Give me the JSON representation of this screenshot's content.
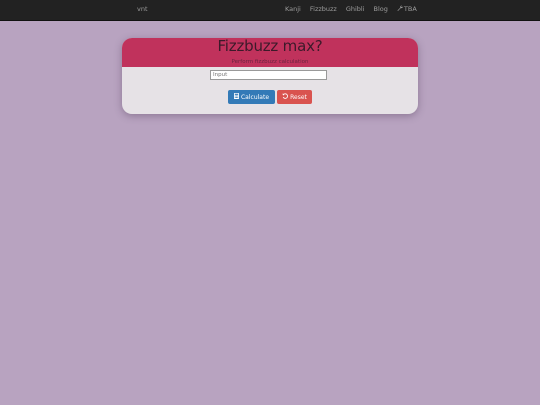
{
  "navbar": {
    "brand": "vnt",
    "links": [
      {
        "label": "Kanji"
      },
      {
        "label": "Fizzbuzz"
      },
      {
        "label": "Ghibli"
      },
      {
        "label": "Blog"
      },
      {
        "label": "TBA",
        "icon": "wrench-icon"
      }
    ]
  },
  "card": {
    "title": "Fizzbuzz max?",
    "subtitle": "Perform fizzbuzz calculation",
    "input": {
      "placeholder": "Input",
      "value": ""
    },
    "buttons": {
      "calculate": {
        "label": "Calculate",
        "icon": "calculator-icon"
      },
      "reset": {
        "label": "Reset",
        "icon": "undo-icon"
      }
    }
  },
  "colors": {
    "page_background": "#b8a3c0",
    "navbar": "#222222",
    "card_header": "#c0325c",
    "card_body": "#e6e2e6",
    "calculate_button": "#337ab7",
    "reset_button": "#d9534f"
  }
}
